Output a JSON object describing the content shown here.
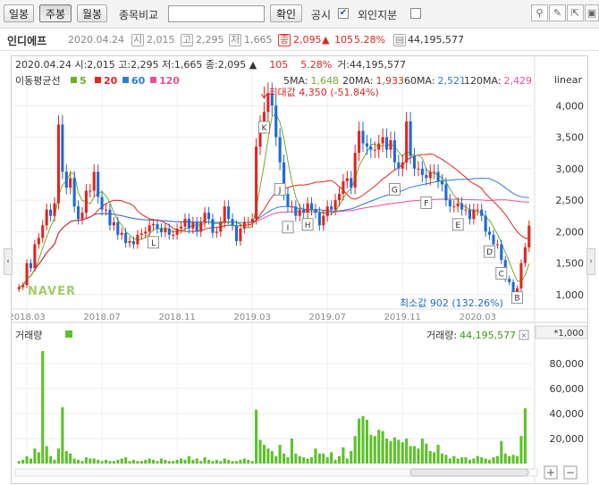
{
  "toolbar": {
    "btn_daily": "일봉",
    "btn_weekly": "주봉",
    "btn_monthly": "월봉",
    "compare_label": "종목비교",
    "confirm": "확인",
    "disclosure": "공시",
    "foreign": "외인지분",
    "disclosure_checked": "✔",
    "tool_icons": [
      "pin-icon",
      "edit-icon",
      "cursor-icon",
      "fullscreen-icon"
    ]
  },
  "stock": {
    "name": "인디에프",
    "date": "2020.04.24",
    "open_tag": "시",
    "open": "2,015",
    "high_tag": "고",
    "high": "2,295",
    "low_tag": "저",
    "low": "1,665",
    "close_tag": "종",
    "close": "2,095",
    "change_arrow": "▲",
    "change": "105",
    "change_pct": "5.28%",
    "volume": "44,195,577"
  },
  "legend": {
    "ohlc_line": "2020.04.24 시:2,015 고:2,295 저:1,665 종:2,095 ▲",
    "change": "105",
    "pct": "5.28%",
    "vol_line": "거:44,195,577",
    "ma_title": "이동평균선",
    "ma5": "5",
    "ma20": "20",
    "ma60": "60",
    "ma120": "120",
    "ma5_label": "5MA:",
    "ma5_val": "1,648",
    "ma20_label": "20MA:",
    "ma20_val": "1,933",
    "ma60_label": "60MA:",
    "ma60_val": "2,521",
    "ma120_label": "120MA:",
    "ma120_val": "2,429",
    "scale": "linear",
    "max_label": "최대값 4,350 (-51.84%)",
    "min_label": "최소값 902 (132.26%)",
    "watermark": "NAVER",
    "vol_title": "거래량",
    "vol_value_label": "거래량:",
    "vol_value": "44,195,577",
    "vol_unit": "*1,000",
    "colors": {
      "ma5": "#6fae2a",
      "ma20": "#e0261f",
      "ma60": "#2e7bd3",
      "ma120": "#e84f9e",
      "up": "#e0261f",
      "down": "#1c6bd6",
      "volume": "#5cc12a"
    }
  },
  "chart_data": [
    {
      "type": "candlestick",
      "title": "인디에프",
      "scale": "linear",
      "ylim": [
        800,
        4500
      ],
      "yticks": [
        1000,
        1500,
        2000,
        2500,
        3000,
        3500,
        4000
      ],
      "ytick_labels": [
        "1,000",
        "1,500",
        "2,000",
        "2,500",
        "3,000",
        "3,500",
        "4,000"
      ],
      "x_labels": [
        "2018.03",
        "2018.07",
        "2018.11",
        "2019.03",
        "2019.07",
        "2019.11",
        "2020.03"
      ],
      "close": [
        1120,
        1150,
        1500,
        1420,
        1800,
        1900,
        2100,
        2350,
        2250,
        2450,
        3700,
        2950,
        2700,
        2850,
        2400,
        2200,
        2300,
        2650,
        2650,
        2950,
        2550,
        2350,
        2350,
        2100,
        2150,
        1950,
        1980,
        1820,
        1850,
        1800,
        1950,
        1970,
        2000,
        2100,
        2120,
        2050,
        1990,
        2050,
        1950,
        1950,
        2050,
        2080,
        2200,
        2050,
        2150,
        2000,
        2150,
        2300,
        2200,
        1980,
        2000,
        2150,
        2400,
        2200,
        2100,
        1850,
        2050,
        2150,
        2150,
        2200,
        3350,
        3700,
        3900,
        4200,
        4000,
        3500,
        3100,
        2600,
        2400,
        2400,
        2250,
        2350,
        2300,
        2450,
        2350,
        2300,
        2100,
        2250,
        2400,
        2350,
        2500,
        2600,
        2800,
        2850,
        2700,
        3250,
        3600,
        3400,
        3350,
        3300,
        3300,
        3400,
        3500,
        3300,
        3450,
        3100,
        3000,
        3100,
        3750,
        3200,
        3000,
        3000,
        2900,
        2850,
        2950,
        2950,
        2800,
        2750,
        2500,
        2400,
        2400,
        2450,
        2350,
        2350,
        2200,
        2350,
        2350,
        2250,
        2000,
        1950,
        1800,
        1800,
        1550,
        1250,
        1200,
        1000,
        1100,
        1500,
        1750,
        2095
      ],
      "high": 4350,
      "high_label": "K",
      "low": 902,
      "low_label": "B",
      "event_markers": [
        "L",
        "K",
        "J",
        "I",
        "H",
        "G",
        "F",
        "E",
        "D",
        "C",
        "B"
      ],
      "series": [
        {
          "name": "5MA",
          "last": 1648
        },
        {
          "name": "20MA",
          "last": 1933
        },
        {
          "name": "60MA",
          "last": 2521
        },
        {
          "name": "120MA",
          "last": 2429
        }
      ]
    },
    {
      "type": "bar",
      "title": "거래량",
      "ylabel": "*1,000",
      "yticks": [
        20000,
        40000,
        60000,
        80000
      ],
      "ytick_labels": [
        "20,000",
        "40,000",
        "60,000",
        "80,000"
      ],
      "ylim": [
        0,
        100000
      ],
      "last_value": 44195577,
      "values": [
        2000,
        3000,
        6000,
        4000,
        12000,
        9000,
        90000,
        14000,
        6000,
        3000,
        12000,
        45000,
        10000,
        8000,
        4000,
        3000,
        2000,
        5000,
        4000,
        4000,
        3000,
        2000,
        3000,
        2000,
        2000,
        3000,
        4000,
        5000,
        2000,
        3000,
        2000,
        2000,
        3000,
        4000,
        3000,
        2000,
        4000,
        3000,
        2000,
        2000,
        3000,
        4000,
        3000,
        6000,
        3000,
        4000,
        2000,
        5000,
        3000,
        2000,
        3000,
        2000,
        4000,
        3000,
        2000,
        2000,
        3000,
        4000,
        3000,
        2000,
        43000,
        19000,
        15000,
        12000,
        10000,
        6000,
        15000,
        8000,
        5000,
        20000,
        8000,
        6000,
        5000,
        4000,
        5000,
        12000,
        8000,
        8000,
        5000,
        9000,
        3000,
        6000,
        13000,
        4000,
        10000,
        22000,
        36000,
        38000,
        35000,
        23000,
        22000,
        27000,
        26000,
        20000,
        18000,
        21000,
        19000,
        17000,
        20000,
        14000,
        14000,
        12000,
        20000,
        16000,
        10000,
        9000,
        15000,
        8000,
        7000,
        4000,
        6000,
        4000,
        5000,
        5000,
        3000,
        4000,
        6000,
        5000,
        4000,
        3000,
        5000,
        6000,
        18000,
        8000,
        6000,
        7000,
        6000,
        22000,
        44195
      ]
    }
  ]
}
